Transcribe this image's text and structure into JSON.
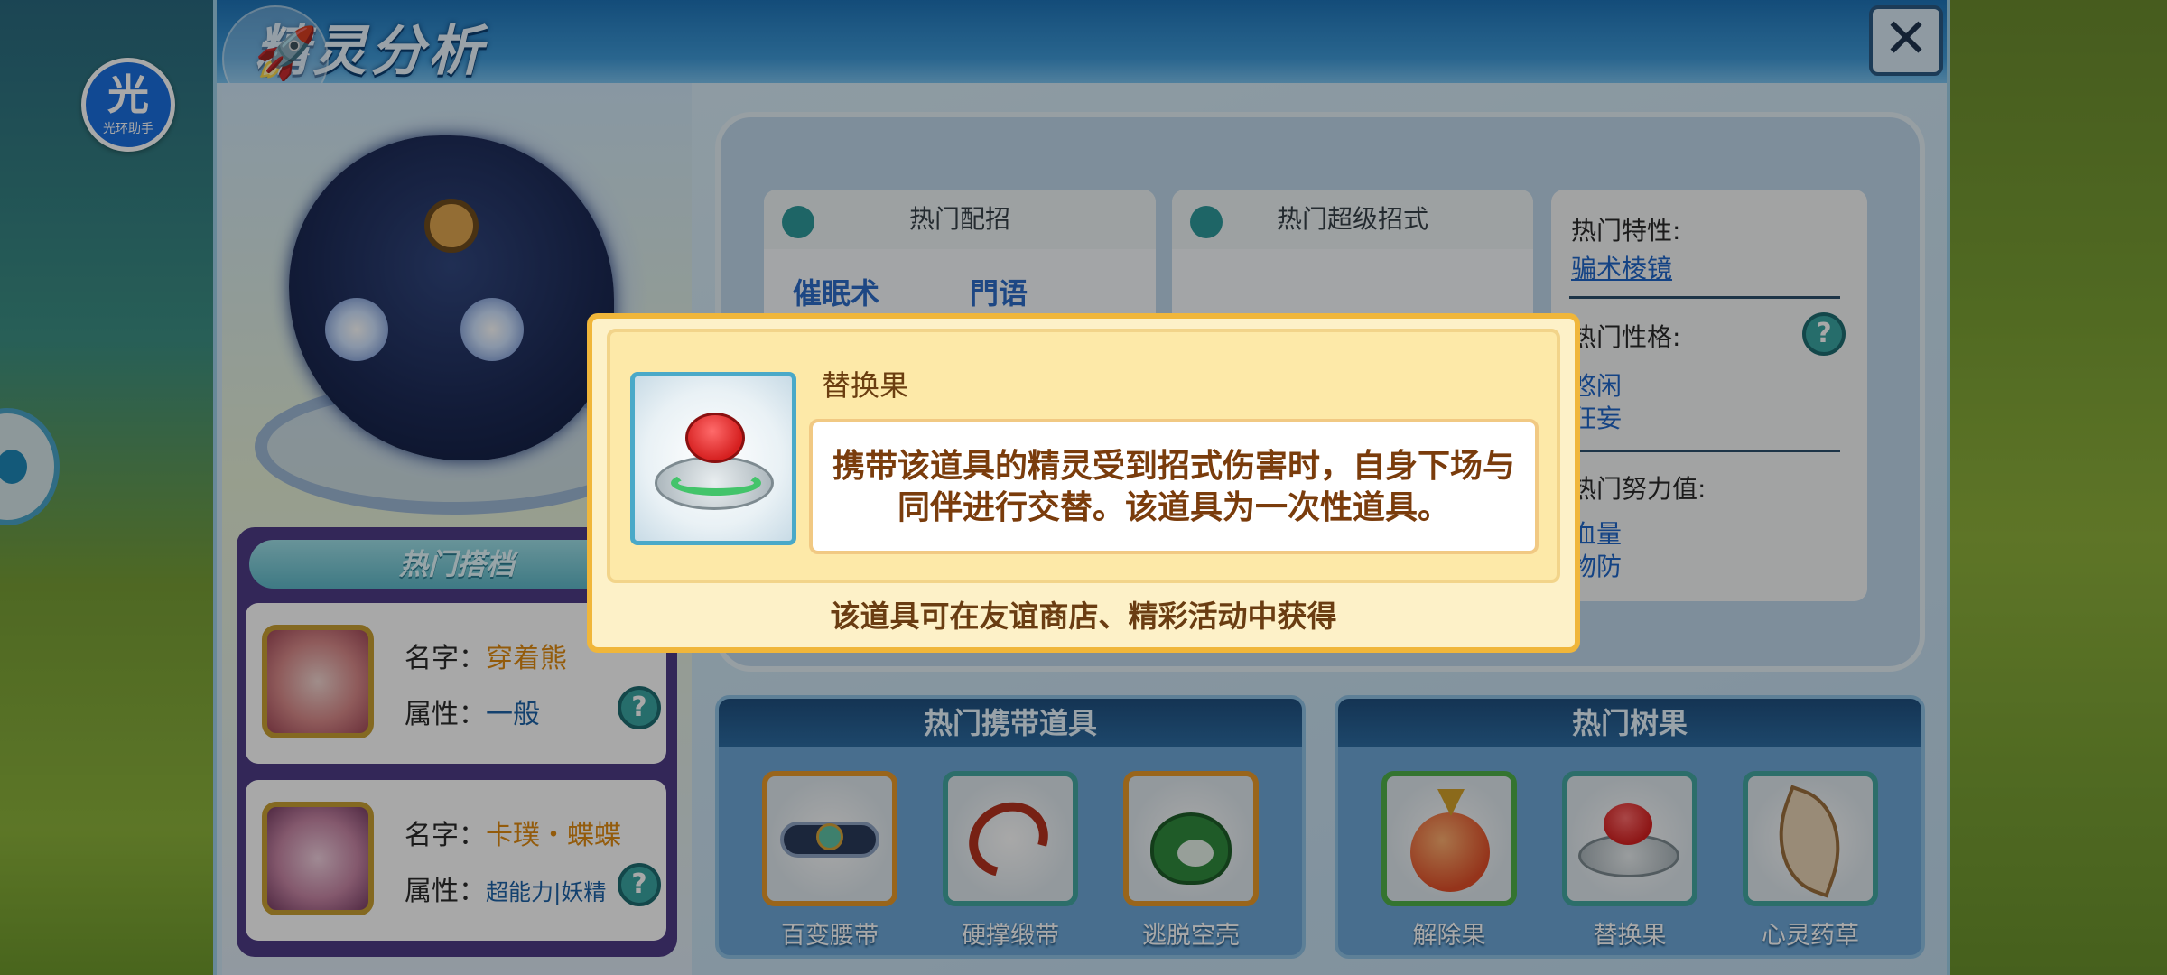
{
  "assistant": {
    "glyph": "光",
    "label": "光环助手"
  },
  "header": {
    "title": "精灵分析",
    "close_label": "✕"
  },
  "partners": {
    "title": "热门搭档",
    "name_label": "名字：",
    "type_label": "属性：",
    "items": [
      {
        "name": "穿着熊",
        "type": "一般"
      },
      {
        "name": "卡璞・蝶蝶",
        "type": "超能力|妖精"
      }
    ]
  },
  "analysis": {
    "moves_box": {
      "title": "热门配招",
      "moves": [
        "催眠术",
        "門语"
      ]
    },
    "super_moves_box": {
      "title": "热门超级招式"
    },
    "traits": {
      "ability_label": "热门特性:",
      "ability_value": "骗术棱镜",
      "nature_label": "热门性格:",
      "nature_values": [
        "悠闲",
        "狂妄"
      ],
      "effort_label": "热门努力值:",
      "effort_values": [
        "血量",
        "物防"
      ]
    }
  },
  "held_items": {
    "title": "热门携带道具",
    "items": [
      {
        "label": "百变腰带",
        "icon": "belt-icon"
      },
      {
        "label": "硬撑缎带",
        "icon": "ribbon-icon"
      },
      {
        "label": "逃脱空壳",
        "icon": "shell-icon"
      }
    ]
  },
  "berries": {
    "title": "热门树果",
    "items": [
      {
        "label": "解除果",
        "icon": "berry-icon"
      },
      {
        "label": "替换果",
        "icon": "switch-button-icon"
      },
      {
        "label": "心灵药草",
        "icon": "herb-leaf-icon"
      }
    ]
  },
  "popup": {
    "item_name": "替换果",
    "description_line1": "携带该道具的精灵受到招式伤害时，自身下场与",
    "description_line2": "同伴进行交替。该道具为一次性道具。",
    "source": "该道具可在友谊商店、精彩活动中获得"
  },
  "colors": {
    "accent_orange": "#f0b63a",
    "header_blue": "#1e74b8",
    "link_blue": "#1f67c8"
  }
}
